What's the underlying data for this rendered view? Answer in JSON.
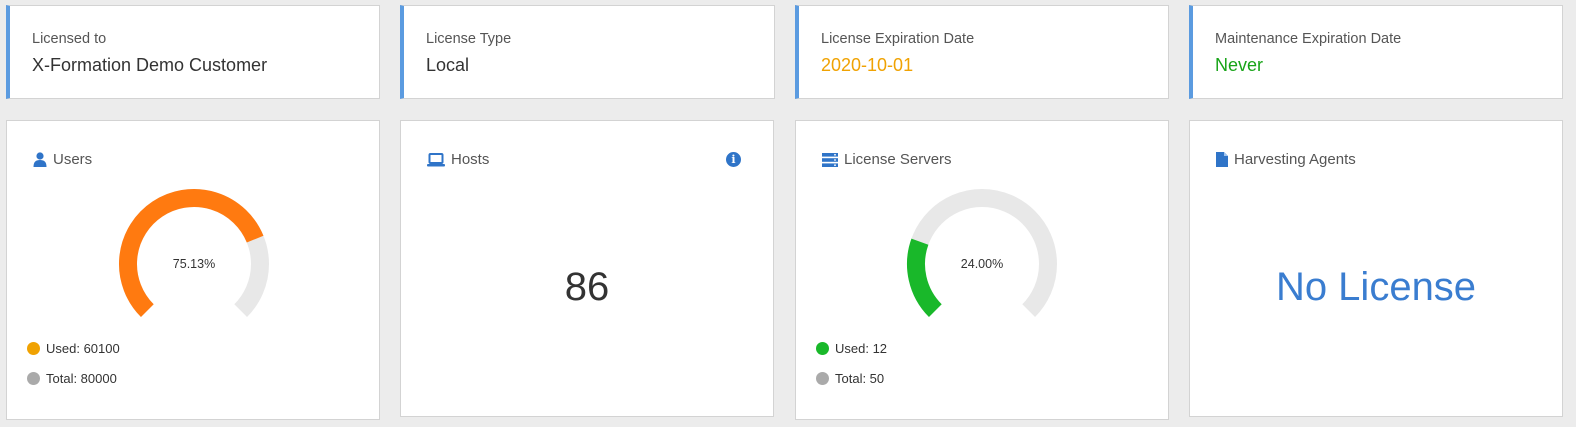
{
  "info_cards": [
    {
      "label": "Licensed to",
      "value": "X-Formation Demo Customer",
      "value_color": "#333333"
    },
    {
      "label": "License Type",
      "value": "Local",
      "value_color": "#333333"
    },
    {
      "label": "License Expiration Date",
      "value": "2020-10-01",
      "value_color": "#f0a202"
    },
    {
      "label": "Maintenance Expiration Date",
      "value": "Never",
      "value_color": "#18a418"
    }
  ],
  "users": {
    "title": "Users",
    "icon": "user-icon",
    "percent_label": "75.13%",
    "fraction": 0.7513,
    "used_label": "Used: 60100",
    "total_label": "Total: 80000",
    "used_color": "#f0a202",
    "arc_color": "#ff7a10",
    "total_color": "#aaaaaa"
  },
  "hosts": {
    "title": "Hosts",
    "icon": "laptop-icon",
    "count": "86",
    "info_icon": "info-icon",
    "info_glyph": "i"
  },
  "license_servers": {
    "title": "License Servers",
    "icon": "server-icon",
    "percent_label": "24.00%",
    "fraction": 0.24,
    "used_label": "Used: 12",
    "total_label": "Total: 50",
    "used_color": "#19b82a",
    "arc_color": "#19b82a",
    "total_color": "#aaaaaa"
  },
  "harvesting_agents": {
    "title": "Harvesting Agents",
    "icon": "document-icon",
    "status": "No License"
  },
  "colors": {
    "accent": "#5b9be0",
    "icon_blue": "#2f74c8",
    "track": "#e8e8e8"
  }
}
